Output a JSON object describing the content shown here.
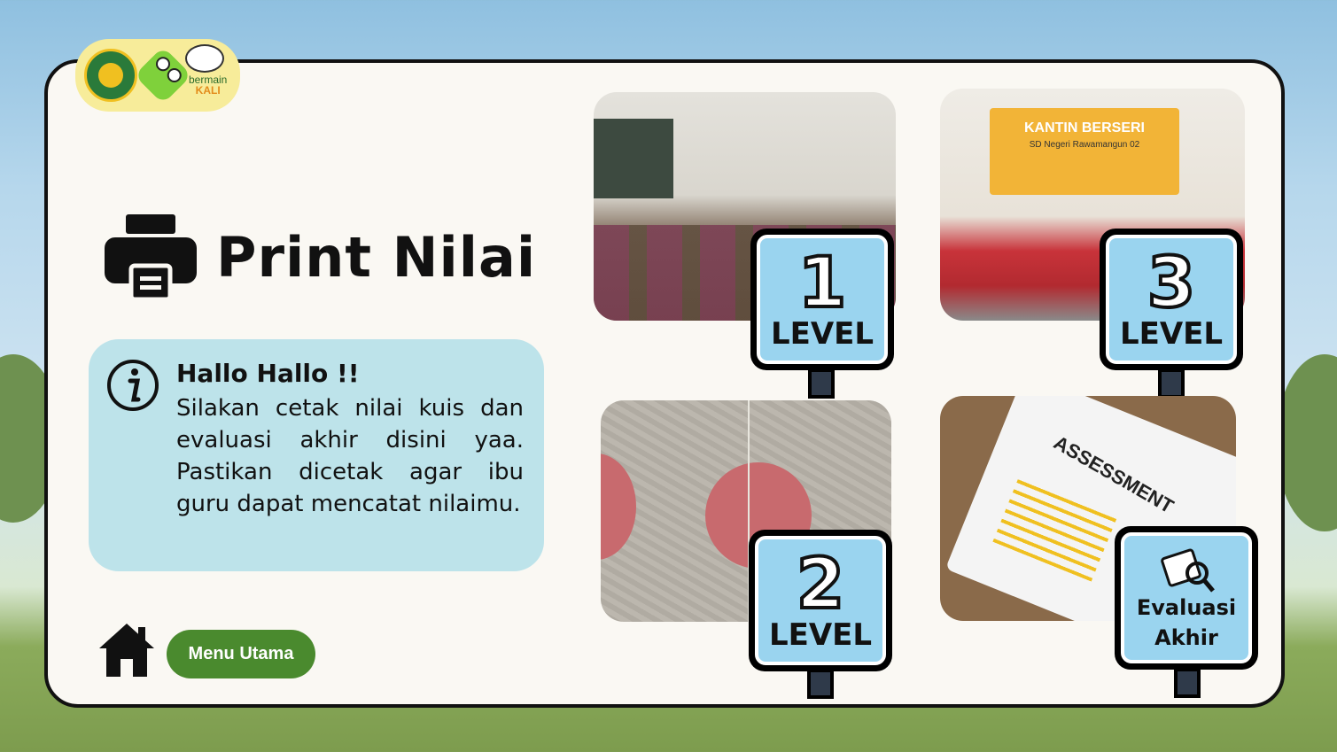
{
  "app": {
    "brand_line1": "bermain",
    "brand_line2": "KALI"
  },
  "page": {
    "title": "Print Nilai",
    "title_icon": "printer-icon"
  },
  "info": {
    "icon": "info-icon",
    "heading": "Hallo Hallo !!",
    "body": "Silakan cetak nilai kuis dan evaluasi akhir disini yaa. Pastikan dicetak agar ibu guru dapat mencatat nilaimu."
  },
  "nav": {
    "home_icon": "home-icon",
    "menu_label": "Menu Utama"
  },
  "levels": [
    {
      "number": "1",
      "label": "LEVEL",
      "photo": "classroom"
    },
    {
      "number": "2",
      "label": "LEVEL",
      "photo": "school-court"
    },
    {
      "number": "3",
      "label": "LEVEL",
      "photo": "school-canteen"
    }
  ],
  "canteen_banner": {
    "title": "KANTIN BERSERI",
    "subtitle": "SD Negeri Rawamangun 02"
  },
  "assessment_photo": {
    "word": "ASSESSMENT"
  },
  "evaluation": {
    "line1": "Evaluasi",
    "line2": "Akhir",
    "icon": "clipboard-search-icon"
  },
  "colors": {
    "sign_blue": "#9ad4ef",
    "info_box": "#bde3ea",
    "menu_button": "#4a8a2e",
    "logo_badge": "#f7ec9a"
  }
}
